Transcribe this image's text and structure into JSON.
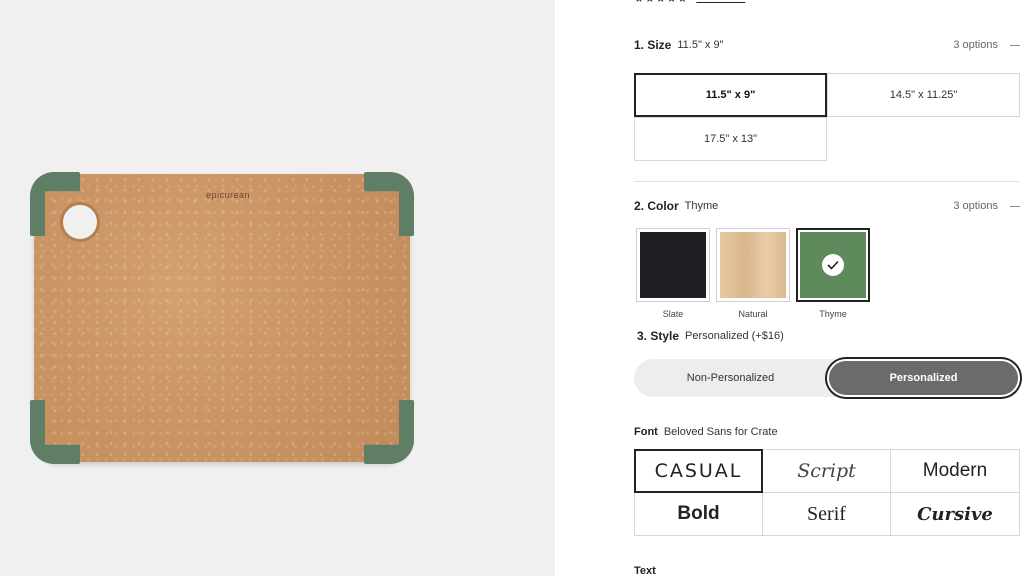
{
  "product": {
    "brand_mark": "epicurean",
    "board_color": "#c99363",
    "corner_color": "#5f7e65"
  },
  "rating": {
    "stars": "★★★★★",
    "review_link": ""
  },
  "size_option": {
    "title": "1. Size",
    "selected_value": "11.5\" x 9\"",
    "count": "3 options",
    "choices": [
      "11.5\" x 9\"",
      "14.5\" x 11.25\"",
      "17.5\" x 13\""
    ]
  },
  "color_option": {
    "title": "2. Color",
    "selected_value": "Thyme",
    "count": "3 options",
    "swatches": [
      {
        "label": "Slate",
        "color": "#1e1f22",
        "icon": ""
      },
      {
        "label": "Natural",
        "color": "#e1c29b",
        "icon": ""
      },
      {
        "label": "Thyme",
        "color": "#5e8a5c",
        "icon": "check-icon"
      }
    ]
  },
  "style_option": {
    "title": "3. Style",
    "selected_value": "Personalized (+$16)",
    "choices": [
      "Non-Personalized",
      "Personalized"
    ]
  },
  "font_option": {
    "title": "Font",
    "selected_value": "Beloved Sans for Crate",
    "choices": [
      "CASUAL",
      "Script",
      "Modern",
      "Bold",
      "Serif",
      "Cursive"
    ]
  },
  "text_option": {
    "title": "Text"
  }
}
